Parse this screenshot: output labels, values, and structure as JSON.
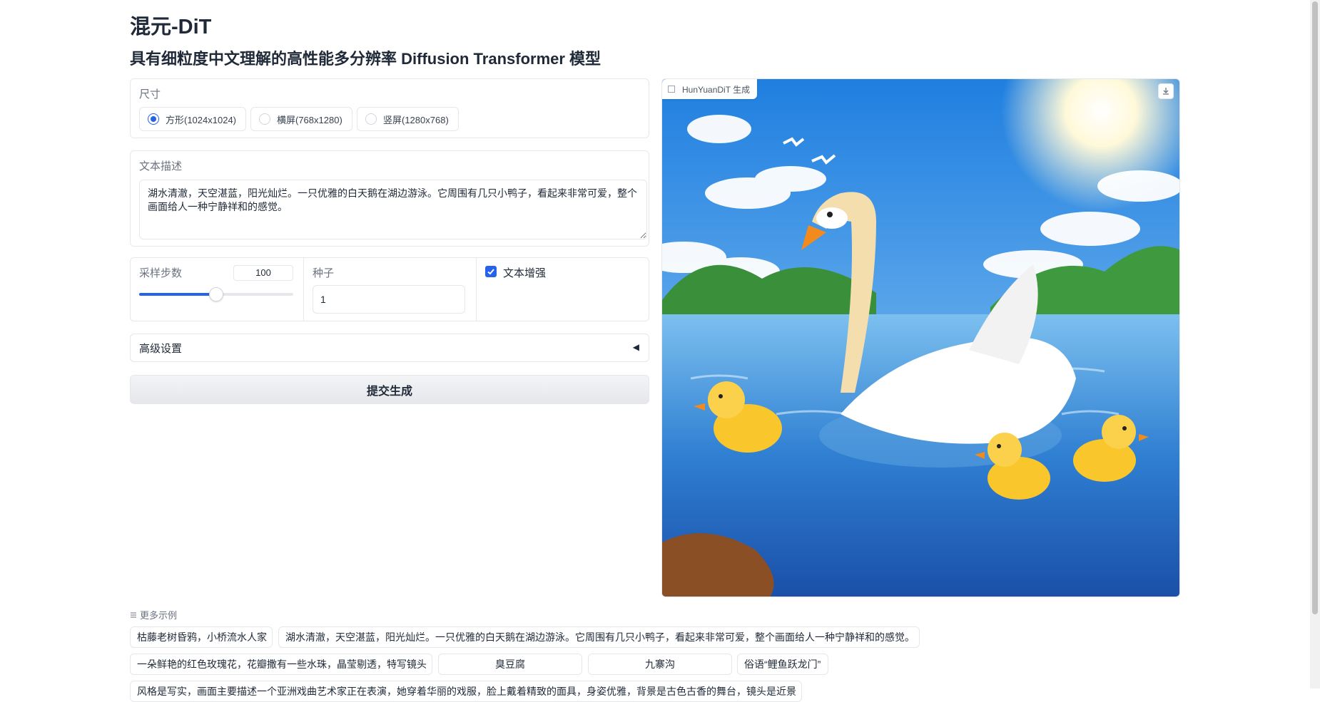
{
  "header": {
    "title": "混元-DiT",
    "subtitle": "具有细粒度中文理解的高性能多分辨率 Diffusion Transformer 模型"
  },
  "size": {
    "label": "尺寸",
    "options": [
      "方形(1024x1024)",
      "横屏(768x1280)",
      "竖屏(1280x768)"
    ],
    "selected": "方形(1024x1024)"
  },
  "prompt": {
    "label": "文本描述",
    "value": "湖水清澈，天空湛蓝，阳光灿烂。一只优雅的白天鹅在湖边游泳。它周围有几只小鸭子，看起来非常可爱，整个画面给人一种宁静祥和的感觉。"
  },
  "sampling": {
    "label": "采样步数",
    "value": "100",
    "fraction": 0.5
  },
  "seed": {
    "label": "种子",
    "value": "1"
  },
  "enhance": {
    "label": "文本增强",
    "checked": true
  },
  "advanced": {
    "label": "高级设置",
    "arrow": "◀"
  },
  "submit": {
    "label": "提交生成"
  },
  "output": {
    "badge": "HunYuanDiT 生成",
    "icons": [
      "image-icon",
      "download-icon"
    ]
  },
  "examples": {
    "label": "更多示例",
    "items": [
      "枯藤老树昏鸦，小桥流水人家",
      "湖水清澈，天空湛蓝，阳光灿烂。一只优雅的白天鹅在湖边游泳。它周围有几只小鸭子，看起来非常可爱，整个画面给人一种宁静祥和的感觉。",
      "一朵鲜艳的红色玫瑰花，花瓣撒有一些水珠，晶莹剔透，特写镜头",
      "臭豆腐",
      "九寨沟",
      "俗语“鲤鱼跃龙门”",
      "风格是写实，画面主要描述一个亚洲戏曲艺术家正在表演，她穿着华丽的戏服，脸上戴着精致的面具，身姿优雅，背景是古色古香的舞台，镜头是近景"
    ]
  },
  "colors": {
    "accent": "#2563eb",
    "border": "#e5e7eb"
  }
}
